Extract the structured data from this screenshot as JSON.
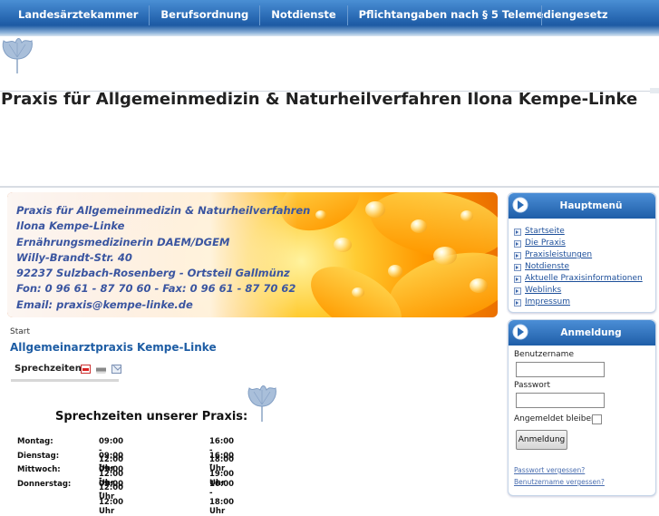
{
  "topnav": {
    "items": [
      "Landesärztekammer",
      "Berufsordnung",
      "Notdienste",
      "Pflichtangaben nach § 5 Telemediengesetz"
    ]
  },
  "site": {
    "title": "Praxis für Allgemeinmedizin & Naturheilverfahren Ilona Kempe-Linke"
  },
  "banner": {
    "lines": [
      "Praxis für Allgemeinmedizin & Naturheilverfahren",
      "Ilona Kempe-Linke",
      "Ernährungsmedizinerin DAEM/DGEM",
      "Willy-Brandt-Str. 40",
      "92237 Sulzbach-Rosenberg - Ortsteil Gallmünz",
      "Fon: 0 96 61 - 87 70 60 - Fax: 0 96 61 - 87 70 62",
      "Email: praxis@kempe-linke.de"
    ]
  },
  "content": {
    "breadcrumb": "Start",
    "title": "Allgemeinarztpraxis Kempe-Linke",
    "sprechzeiten_label": "Sprechzeiten:",
    "hours_title": "Sprechzeiten unserer Praxis:",
    "hours": [
      {
        "day": "Montag:",
        "am": "09:00 - 12:00 Uhr",
        "pm": "16:00 - 18:00 Uhr"
      },
      {
        "day": "Dienstag:",
        "am": "09:00 - 12:00 Uhr",
        "pm": "16:00 - 19:00 Uhr"
      },
      {
        "day": "Mittwoch:",
        "am": "09:00 - 12:00 Uhr",
        "pm": ""
      },
      {
        "day": "Donnerstag:",
        "am": "09:00 - 12:00 Uhr",
        "pm": "16:00 - 18:00 Uhr"
      }
    ]
  },
  "mainmenu": {
    "title": "Hauptmenü",
    "items": [
      "Startseite",
      "Die Praxis",
      "Praxisleistungen",
      "Notdienste",
      "Aktuelle Praxisinformationen",
      "Weblinks",
      "Impressum"
    ]
  },
  "login": {
    "title": "Anmeldung",
    "username_label": "Benutzername",
    "password_label": "Passwort",
    "remember_label": "Angemeldet bleiben",
    "submit_label": "Anmeldung",
    "forgot_password": "Passwort vergessen?",
    "forgot_username": "Benutzername vergessen?"
  },
  "colors": {
    "nav_blue": "#2b6cb6",
    "link_blue": "#1d4f9a",
    "title_blue": "#1e5da4"
  }
}
